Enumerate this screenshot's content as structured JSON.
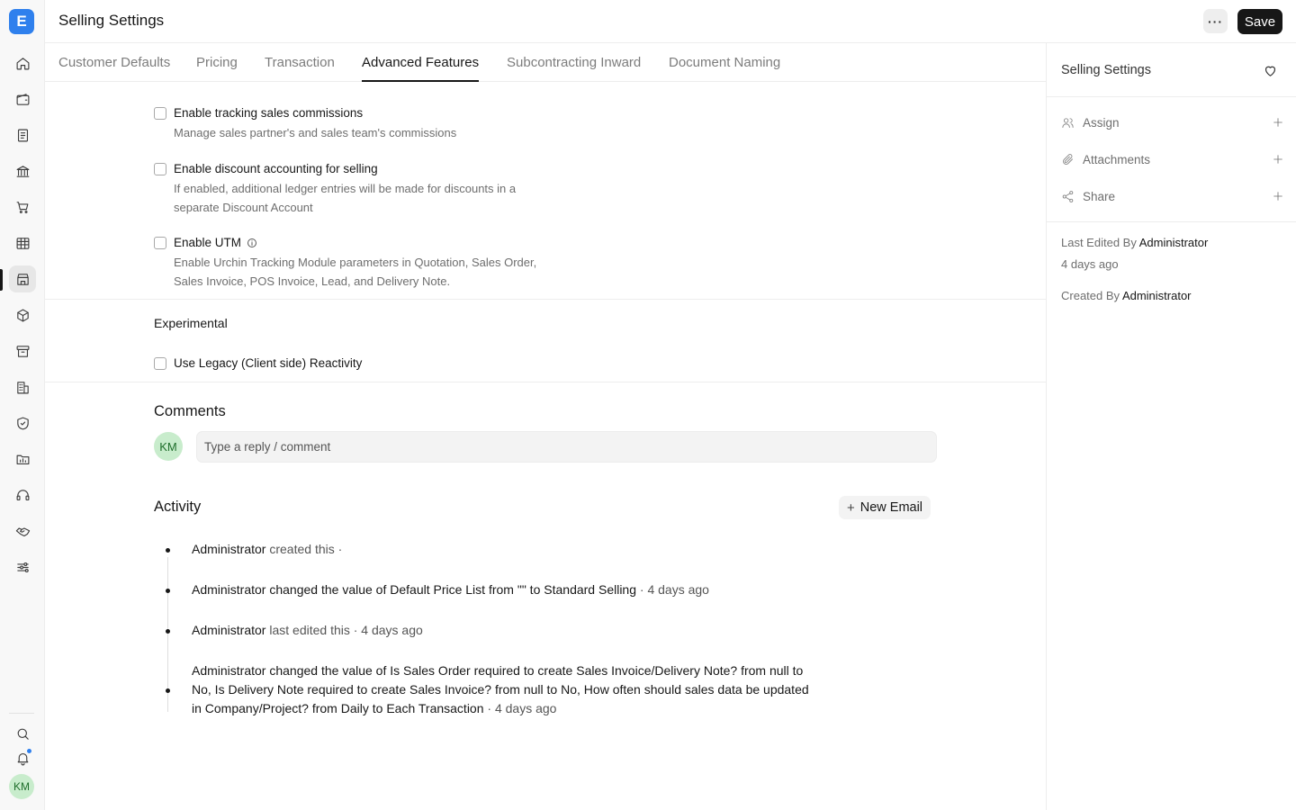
{
  "app": {
    "logo_letter": "E",
    "page_title": "Selling Settings",
    "save_label": "Save",
    "more_label": "···",
    "user_initials": "KM"
  },
  "rail": {
    "items": [
      "home-icon",
      "wallet-icon",
      "document-icon",
      "bank-icon",
      "cart-icon",
      "table-icon",
      "store-icon",
      "package-icon",
      "archive-icon",
      "building-icon",
      "shield-icon",
      "folder-icon",
      "headset-icon",
      "handshake-icon",
      "sliders-icon"
    ],
    "active": "store-icon",
    "bottom": [
      "search-icon",
      "bell-icon"
    ]
  },
  "tabs": [
    "Customer Defaults",
    "Pricing",
    "Transaction",
    "Advanced Features",
    "Subcontracting Inward",
    "Document Naming"
  ],
  "active_tab": "Advanced Features",
  "fields": {
    "commissions": {
      "label": "Enable tracking sales commissions",
      "description": "Manage sales partner's and sales team's commissions",
      "checked": false
    },
    "discount": {
      "label": "Enable discount accounting for selling",
      "description": "If enabled, additional ledger entries will be made for discounts in a separate Discount Account",
      "checked": false
    },
    "utm": {
      "label": "Enable UTM",
      "description": "Enable Urchin Tracking Module parameters in Quotation, Sales Order, Sales Invoice, POS Invoice, Lead, and Delivery Note.",
      "checked": false
    }
  },
  "experimental": {
    "title": "Experimental",
    "legacy": {
      "label": "Use Legacy (Client side) Reactivity",
      "checked": false
    }
  },
  "comments": {
    "title": "Comments",
    "placeholder": "Type a reply / comment"
  },
  "activity": {
    "title": "Activity",
    "new_email": "New Email",
    "items": [
      {
        "user": "Administrator",
        "pre": " created this ·"
      },
      {
        "user": "Administrator",
        "s1": " changed the value of Default Price List from ",
        "v1": "\"\"",
        "s2": " to ",
        "v2": "Standard Selling",
        "time": " · 4 days ago"
      },
      {
        "user": "Administrator",
        "pre": " last edited this · 4 days ago"
      },
      {
        "user": "Administrator",
        "s1": " changed the value of Is Sales Order required to create Sales Invoice/Delivery Note? from ",
        "v1": "null",
        "s2": " to ",
        "v2": "No",
        "s3": ", Is Delivery Note required to create Sales Invoice? from ",
        "v3": "null",
        "s4": " to ",
        "v4": "No",
        "s5": ", How often should sales data be updated in Company/Project? from ",
        "v5": "Daily",
        "s6": " to ",
        "v6": "Each Transaction",
        "time": " · 4 days ago"
      }
    ]
  },
  "sidebar": {
    "title": "Selling Settings",
    "assign": "Assign",
    "attachments": "Attachments",
    "share": "Share",
    "last_edited_label": "Last Edited By ",
    "last_edited_by": "Administrator",
    "last_edited_time": "4 days ago",
    "created_label": "Created By ",
    "created_by": "Administrator"
  },
  "colors": {
    "accent": "#2f80ed",
    "primary_button": "#171717",
    "avatar_bg": "#c8eccc"
  }
}
